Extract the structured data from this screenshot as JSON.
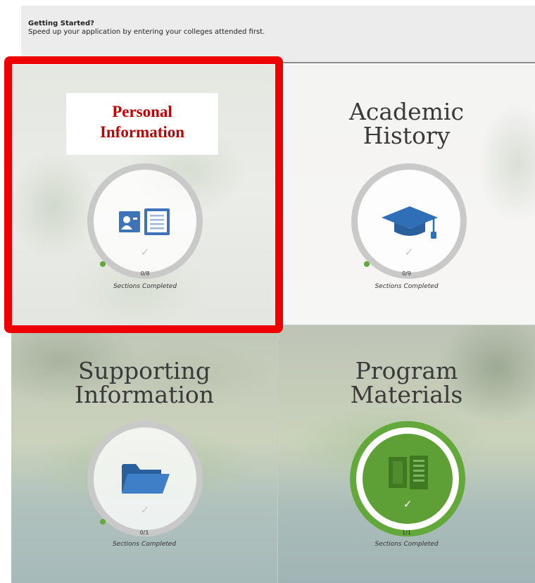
{
  "notice": {
    "title": "Getting Started?",
    "body": "Speed up your application by entering your colleges attended first."
  },
  "tiles": [
    {
      "title": "Personal Information",
      "title_lines": [
        "Personal",
        "Information"
      ],
      "icon": "id-card-icon",
      "count": "0/8",
      "status": "Sections Completed",
      "progress": 0,
      "highlighted": true
    },
    {
      "title_lines": [
        "Academic",
        "History"
      ],
      "icon": "graduation-cap-icon",
      "count": "0/9",
      "status": "Sections Completed",
      "progress": 0
    },
    {
      "title_lines": [
        "Supporting",
        "Information"
      ],
      "icon": "folder-icon",
      "count": "0/1",
      "status": "Sections Completed",
      "progress": 0
    },
    {
      "title_lines": [
        "Program",
        "Materials"
      ],
      "icon": "book-icon",
      "count": "1/1",
      "status": "Sections Completed",
      "progress": 1
    }
  ],
  "colors": {
    "highlight": "#ee0000",
    "label_red": "#c00000",
    "progress_green": "#62a83a",
    "ring_grey": "#c9c9c9",
    "icon_blue": "#3f73b8"
  }
}
